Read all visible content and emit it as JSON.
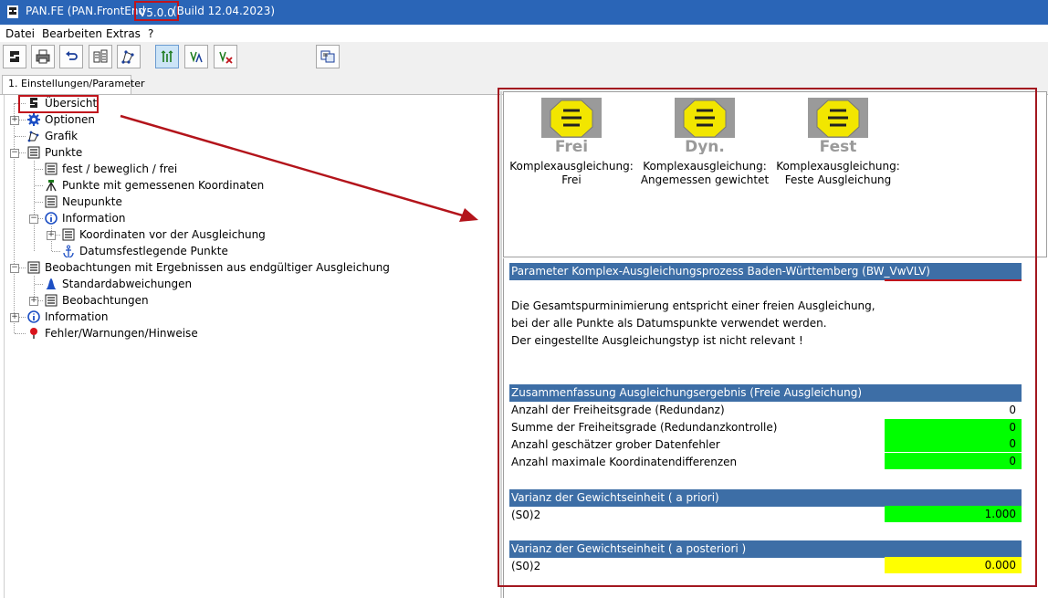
{
  "window": {
    "title_prefix": "PAN.FE (PAN.FrontEnd",
    "version": "V5.0.0",
    "build": "(Build 12.04.2023)"
  },
  "menu": [
    "Datei",
    "Bearbeiten",
    "Extras",
    "?"
  ],
  "toolbar": {
    "buttons": [
      "app-icon",
      "print-icon",
      "undo-icon",
      "compare-icon",
      "network-icon",
      "adjust-free-icon",
      "adjust-weighted-icon",
      "adjust-fixed-icon",
      "window-switch-icon"
    ]
  },
  "tabs": [
    "1. Einstellungen/Parameter"
  ],
  "tree": {
    "items": [
      "Übersicht",
      "Optionen",
      "Grafik",
      "Punkte",
      "fest / beweglich / frei",
      "Punkte mit gemessenen Koordinaten",
      "Neupunkte",
      "Information",
      "Koordinaten vor der Ausgleichung",
      "Datumsfestlegende Punkte",
      "Beobachtungen mit Ergebnissen aus endgültiger Ausgleichung",
      "Standardabweichungen",
      "Beobachtungen",
      "Information",
      "Fehler/Warnungen/Hinweise"
    ]
  },
  "cards": [
    {
      "logo_text": "Frei",
      "caption_line1": "Komplexausgleichung:",
      "caption_line2": "Frei"
    },
    {
      "logo_text": "Dyn.",
      "caption_line1": "Komplexausgleichung:",
      "caption_line2": "Angemessen gewichtet"
    },
    {
      "logo_text": "Fest",
      "caption_line1": "Komplexausgleichung:",
      "caption_line2": "Feste Ausgleichung"
    }
  ],
  "parameter": {
    "header": "Parameter Komplex-Ausgleichungsprozess Baden-Württemberg (BW_VwVLV)",
    "lines": [
      "Die Gesamtspurminimierung entspricht einer freien Ausgleichung,",
      "bei der alle Punkte als Datumspunkte verwendet werden.",
      "Der eingestellte Ausgleichungstyp ist nicht relevant !"
    ]
  },
  "summary": {
    "header": "Zusammenfassung Ausgleichungsergebnis (Freie Ausgleichung)",
    "rows": [
      {
        "label": "Anzahl der Freiheitsgrade (Redundanz)",
        "value": "0"
      },
      {
        "label": "Summe der Freiheitsgrade (Redundanzkontrolle)",
        "value": "0"
      },
      {
        "label": "Anzahl geschätzer grober Datenfehler",
        "value": "0"
      },
      {
        "label": "Anzahl maximale Koordinatendifferenzen",
        "value": "0"
      }
    ]
  },
  "variance_prior": {
    "header": "Varianz der Gewichtseinheit ( a priori)",
    "label": "(S0)2",
    "value": "1.000"
  },
  "variance_posterior": {
    "header": "Varianz der Gewichtseinheit ( a posteriori )",
    "label": "(S0)2",
    "value": "0.000"
  },
  "colors": {
    "titlebar": "#2a65b7",
    "section_header": "#3d6ea6",
    "ok_green": "#00ff00",
    "warn_yellow": "#ffff00",
    "annotation_red": "#c0141c"
  }
}
